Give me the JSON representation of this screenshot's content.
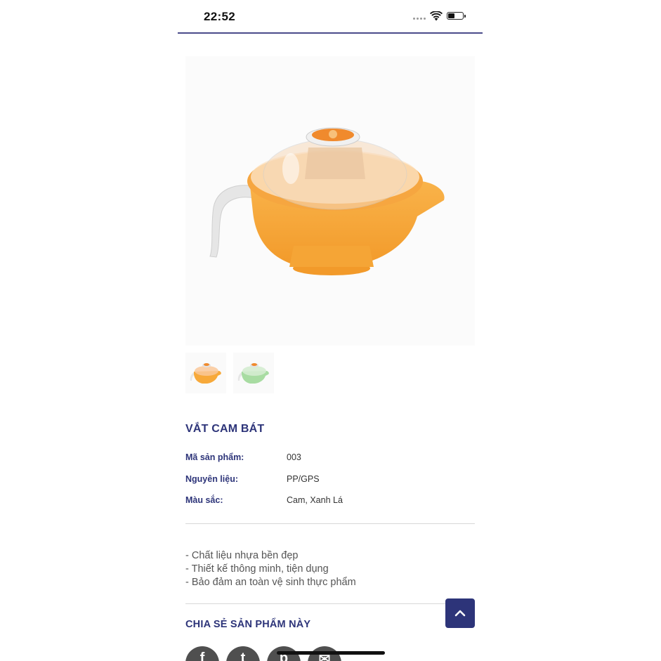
{
  "status_bar": {
    "time": "22:52"
  },
  "gallery": {
    "main_alt": "Vắt cam bát - màu cam",
    "thumbnails": [
      "Cam",
      "Xanh Lá"
    ]
  },
  "product": {
    "title": "VẮT CAM BÁT",
    "specs": [
      {
        "label": "Mã sản phẩm:",
        "value": "003"
      },
      {
        "label": "Nguyên liệu:",
        "value": "PP/GPS"
      },
      {
        "label": "Màu sắc:",
        "value": "Cam, Xanh Lá"
      }
    ],
    "description": [
      "- Chất liệu nhựa bền đẹp",
      "- Thiết kế thông minh, tiện dụng",
      "- Bảo đảm an toàn vệ sinh thực phẩm"
    ]
  },
  "share": {
    "title": "CHIA SẺ SẢN PHẨM NÀY",
    "icons": [
      "facebook-icon",
      "twitter-icon",
      "pinterest-icon",
      "email-icon"
    ],
    "glyphs": [
      "f",
      "t",
      "p",
      "✉"
    ]
  },
  "colors": {
    "brand": "#2d3479",
    "juicer_orange": "#f7a93a",
    "juicer_green": "#a8dca2",
    "share_icon_bg": "#4f4f4f"
  }
}
